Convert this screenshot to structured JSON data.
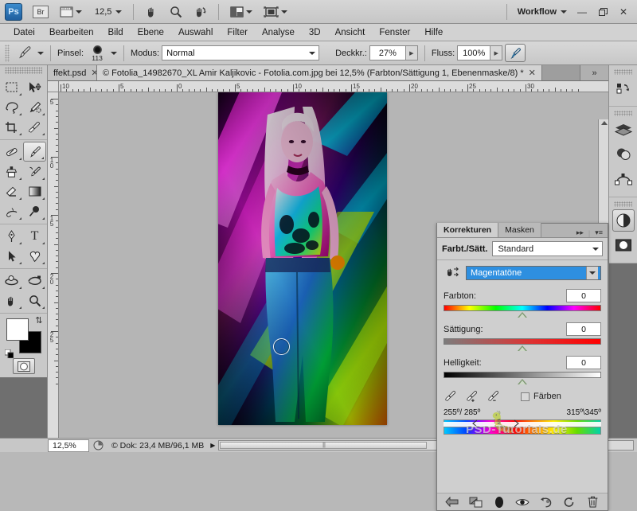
{
  "app": {
    "name": "Adobe Photoshop",
    "logo_text": "Ps",
    "bridge_label": "Br",
    "zoom_level": "12,5",
    "workflow_label": "Workflow",
    "window_buttons": {
      "minimize": "—",
      "restore": "❐",
      "close": "✕"
    }
  },
  "menubar": {
    "items": [
      "Datei",
      "Bearbeiten",
      "Bild",
      "Ebene",
      "Auswahl",
      "Filter",
      "Analyse",
      "3D",
      "Ansicht",
      "Fenster",
      "Hilfe"
    ]
  },
  "options": {
    "brush_label": "Pinsel:",
    "brush_size": "113",
    "mode_label": "Modus:",
    "mode_value": "Normal",
    "opacity_label": "Deckkr.:",
    "opacity_value": "27%",
    "flow_label": "Fluss:",
    "flow_value": "100%"
  },
  "tabs": {
    "items": [
      {
        "title": "ffekt.psd",
        "active": false,
        "close": "✕"
      },
      {
        "title": "© Fotolia_14982670_XL Amir Kaljikovic - Fotolia.com.jpg bei 12,5% (Farbton/Sättigung 1, Ebenenmaske/8) *",
        "active": true,
        "close": "✕"
      }
    ],
    "overflow": "»"
  },
  "rulers": {
    "horizontal": [
      "10",
      "5",
      "0",
      "5",
      "10",
      "15",
      "20",
      "25",
      "30"
    ],
    "vertical": [
      "5",
      "10",
      "15",
      "20",
      "25"
    ],
    "unit": "cm"
  },
  "toolbox": {
    "tools": [
      {
        "name": "rectangular-marquee-tool",
        "glyph": "marquee"
      },
      {
        "name": "move-tool",
        "glyph": "move"
      },
      {
        "name": "lasso-tool",
        "glyph": "lasso"
      },
      {
        "name": "quick-selection-tool",
        "glyph": "quickselect"
      },
      {
        "name": "crop-tool",
        "glyph": "crop"
      },
      {
        "name": "eyedropper-tool",
        "glyph": "eyedropper"
      },
      {
        "name": "spot-healing-brush-tool",
        "glyph": "heal"
      },
      {
        "name": "brush-tool",
        "glyph": "brush"
      },
      {
        "name": "clone-stamp-tool",
        "glyph": "stamp"
      },
      {
        "name": "history-brush-tool",
        "glyph": "historybrush"
      },
      {
        "name": "eraser-tool",
        "glyph": "eraser"
      },
      {
        "name": "gradient-tool",
        "glyph": "gradient"
      },
      {
        "name": "blur-tool",
        "glyph": "blur"
      },
      {
        "name": "dodge-tool",
        "glyph": "dodge"
      },
      {
        "name": "pen-tool",
        "glyph": "pen"
      },
      {
        "name": "type-tool",
        "glyph": "type"
      },
      {
        "name": "path-selection-tool",
        "glyph": "pathselect"
      },
      {
        "name": "custom-shape-tool",
        "glyph": "shape"
      },
      {
        "name": "3d-rotate-tool",
        "glyph": "rotate3d"
      },
      {
        "name": "3d-orbit-tool",
        "glyph": "orbit3d"
      },
      {
        "name": "hand-tool",
        "glyph": "hand"
      },
      {
        "name": "zoom-tool",
        "glyph": "zoom"
      }
    ],
    "active_tool": "brush-tool",
    "foreground_color": "#ffffff",
    "background_color": "#000000"
  },
  "right_dock": {
    "items": [
      {
        "name": "history-panel-icon"
      },
      {
        "name": "layers-panel-icon"
      },
      {
        "name": "channels-panel-icon"
      },
      {
        "name": "paths-panel-icon"
      },
      {
        "name": "adjustments-panel-icon",
        "selected": true
      },
      {
        "name": "masks-panel-icon"
      }
    ]
  },
  "panel": {
    "tabs": [
      {
        "label": "Korrekturen",
        "active": true
      },
      {
        "label": "Masken",
        "active": false
      }
    ],
    "collapse_icon": "▸▸",
    "menu_icon": "▾≡",
    "title": "Farbt./Sätt.",
    "preset_value": "Standard",
    "range_value": "Magentatöne",
    "sliders": [
      {
        "label": "Farbton:",
        "value": "0",
        "track": "hue"
      },
      {
        "label": "Sättigung:",
        "value": "0",
        "track": "sat"
      },
      {
        "label": "Helligkeit:",
        "value": "0",
        "track": "lig"
      }
    ],
    "eyedroppers": [
      "eyedropper-icon",
      "eyedropper-add-icon",
      "eyedropper-subtract-icon"
    ],
    "colorize_label": "Färben",
    "colorize_checked": false,
    "range_left": "255º/ 285º",
    "range_right": "315º\\345º",
    "watermark": "PSD-Tutorials.de",
    "footer_buttons": [
      {
        "name": "return-to-adjustment-list-button",
        "glyph": "back-arrow"
      },
      {
        "name": "clip-to-layer-button",
        "glyph": "clip"
      },
      {
        "name": "toggle-layer-visibility-button",
        "glyph": "fill-circle"
      },
      {
        "name": "preview-eye-button",
        "glyph": "eye"
      },
      {
        "name": "reset-to-previous-button",
        "glyph": "undo"
      },
      {
        "name": "reset-adjustment-button",
        "glyph": "reset"
      },
      {
        "name": "delete-adjustment-layer-button",
        "glyph": "trash"
      }
    ]
  },
  "statusbar": {
    "zoom": "12,5%",
    "doc_info": "© Dok: 23,4 MB/96,1 MB",
    "arrow": "▶"
  }
}
